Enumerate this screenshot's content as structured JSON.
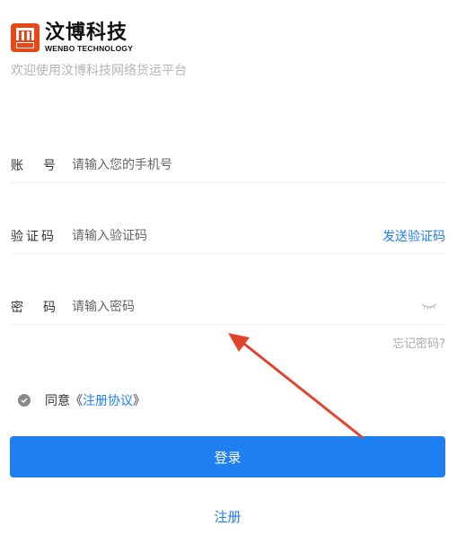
{
  "brand": {
    "name_cn": "汶博科技",
    "name_en": "WENBO TECHNOLOGY",
    "logo_color": "#e8471a"
  },
  "welcome_text": "欢迎使用汶博科技网络货运平台",
  "account": {
    "label": "账号",
    "placeholder": "请输入您的手机号"
  },
  "code": {
    "label": "验证码",
    "placeholder": "请输入验证码",
    "send_label": "发送验证码"
  },
  "password": {
    "label": "密码",
    "placeholder": "请输入密码",
    "visibility_icon": "eye-closed-icon"
  },
  "forgot_label": "忘记密码?",
  "agreement": {
    "prefix": "同意《",
    "link": "注册协议",
    "suffix": "》",
    "checked": true
  },
  "login_label": "登录",
  "register_label": "注册",
  "colors": {
    "accent": "#1e7ff0",
    "annotation": "#e0452c"
  }
}
